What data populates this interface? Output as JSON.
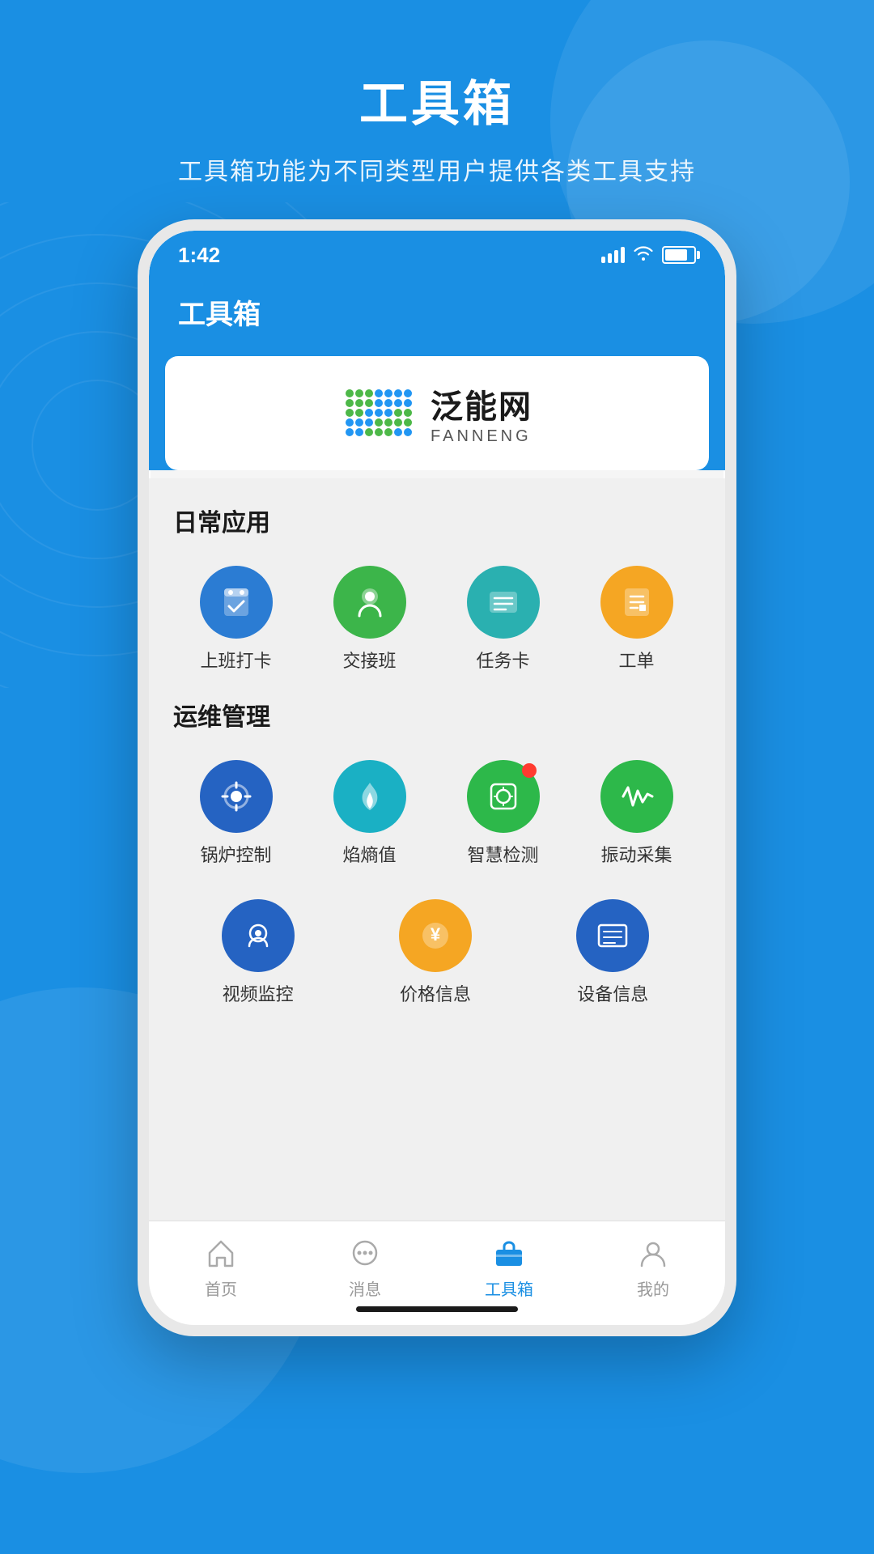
{
  "page": {
    "title": "工具箱",
    "subtitle": "工具箱功能为不同类型用户提供各类工具支持"
  },
  "phone": {
    "status_time": "1:42",
    "header_title": "工具箱"
  },
  "banner": {
    "logo_chinese": "泛能网",
    "logo_english": "FANNENG"
  },
  "daily_section": {
    "title": "日常应用",
    "items": [
      {
        "label": "上班打卡",
        "color": "ic-blue",
        "icon": "checkin"
      },
      {
        "label": "交接班",
        "color": "ic-green",
        "icon": "shift"
      },
      {
        "label": "任务卡",
        "color": "ic-teal",
        "icon": "task"
      },
      {
        "label": "工单",
        "color": "ic-yellow",
        "icon": "workorder"
      }
    ]
  },
  "ops_section": {
    "title": "运维管理",
    "row1": [
      {
        "label": "锅炉控制",
        "color": "ic-dblue",
        "icon": "boiler",
        "badge": false
      },
      {
        "label": "焰熵值",
        "color": "ic-cyan",
        "icon": "flame",
        "badge": false
      },
      {
        "label": "智慧检测",
        "color": "ic-green2",
        "icon": "smart",
        "badge": true
      },
      {
        "label": "振动采集",
        "color": "ic-green3",
        "icon": "vibration",
        "badge": false
      }
    ],
    "row2": [
      {
        "label": "视频监控",
        "color": "ic-cam-blue",
        "icon": "video",
        "badge": false
      },
      {
        "label": "价格信息",
        "color": "ic-gold",
        "icon": "price",
        "badge": false
      },
      {
        "label": "设备信息",
        "color": "ic-blue2",
        "icon": "device",
        "badge": false
      }
    ]
  },
  "bottom_nav": {
    "items": [
      {
        "label": "首页",
        "icon": "home",
        "active": false
      },
      {
        "label": "消息",
        "icon": "message",
        "active": false
      },
      {
        "label": "工具箱",
        "icon": "toolbox",
        "active": true
      },
      {
        "label": "我的",
        "icon": "profile",
        "active": false
      }
    ]
  }
}
